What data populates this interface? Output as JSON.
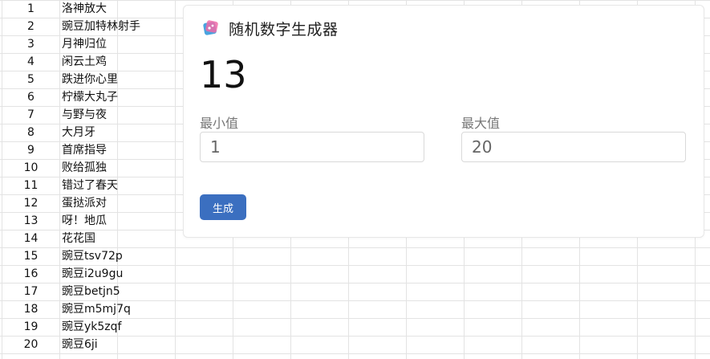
{
  "sheet": {
    "rows": [
      {
        "num": "1",
        "name": "洛神放大"
      },
      {
        "num": "2",
        "name": "豌豆加特林射手"
      },
      {
        "num": "3",
        "name": "月神归位"
      },
      {
        "num": "4",
        "name": "闲云土鸡"
      },
      {
        "num": "5",
        "name": "跌进你心里"
      },
      {
        "num": "6",
        "name": "柠檬大丸子"
      },
      {
        "num": "7",
        "name": "与野与夜"
      },
      {
        "num": "8",
        "name": "大月牙"
      },
      {
        "num": "9",
        "name": "首席指导"
      },
      {
        "num": "10",
        "name": "败给孤独"
      },
      {
        "num": "11",
        "name": "错过了春天"
      },
      {
        "num": "12",
        "name": "蛋挞派对"
      },
      {
        "num": "13",
        "name": "呀！地瓜"
      },
      {
        "num": "14",
        "name": "花花国"
      },
      {
        "num": "15",
        "name": "豌豆tsv72p"
      },
      {
        "num": "16",
        "name": "豌豆i2u9gu"
      },
      {
        "num": "17",
        "name": "豌豆betjn5"
      },
      {
        "num": "18",
        "name": "豌豆m5mj7q"
      },
      {
        "num": "19",
        "name": "豌豆yk5zqf"
      },
      {
        "num": "20",
        "name": "豌豆6ji"
      }
    ]
  },
  "generator": {
    "icon": "dice-icon",
    "title": "随机数字生成器",
    "result": "13",
    "min_label": "最小值",
    "min_value": "1",
    "max_label": "最大值",
    "max_value": "20",
    "button_label": "生成",
    "accent_color": "#3b6fc0"
  }
}
